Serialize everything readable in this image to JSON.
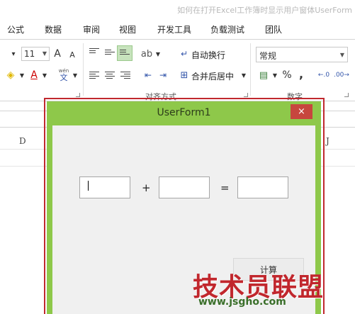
{
  "window": {
    "title": "如何在打开Excel工作簿时显示用户窗体UserForm"
  },
  "menu": {
    "items": [
      "公式",
      "数据",
      "审阅",
      "视图",
      "开发工具",
      "负载测试",
      "团队"
    ]
  },
  "ribbon": {
    "font_size": "11",
    "wrap_text": "自动换行",
    "merge_center": "合并后居中",
    "number_format": "常规",
    "alignment_group": "对齐方式",
    "number_group": "数字",
    "percent": "%",
    "comma": ",",
    "font_grow": "A",
    "font_shrink": "A",
    "font_color_letter": "A",
    "phonetic_top": "wén",
    "phonetic_bottom": "文"
  },
  "sheet": {
    "columns": [
      "D",
      "J"
    ]
  },
  "userform": {
    "title": "UserForm1",
    "close_glyph": "×",
    "plus": "+",
    "equals": "=",
    "textbox1_value": "",
    "textbox2_value": "",
    "textbox3_value": "",
    "command_button_label": "计算"
  },
  "watermark": {
    "main": "技术员联盟",
    "sub": "www.jsgho.com"
  },
  "colors": {
    "userform_frame": "#8ec84a",
    "close_button": "#c7463e",
    "selection_frame": "#c0282e",
    "watermark": "#c1272d"
  }
}
